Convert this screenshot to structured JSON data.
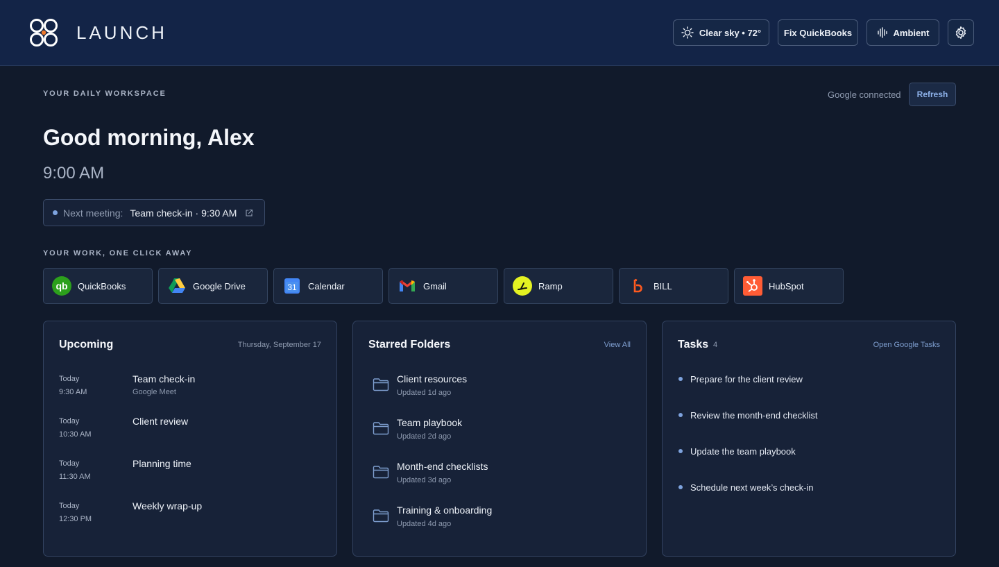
{
  "header": {
    "brand": "LAUNCH",
    "weather_label": "Clear sky • 72°",
    "fix_label": "Fix QuickBooks",
    "ambient_label": "Ambient"
  },
  "workspace": {
    "eyebrow": "YOUR DAILY WORKSPACE",
    "google_status": "Google connected",
    "refresh_label": "Refresh",
    "greeting": "Good morning, Alex",
    "time": "9:00 AM",
    "next_meeting_label": "Next meeting:",
    "next_meeting_value": "Team check-in · 9:30 AM"
  },
  "apps": {
    "eyebrow": "YOUR WORK, ONE CLICK AWAY",
    "items": [
      {
        "label": "QuickBooks",
        "icon": "quickbooks-icon"
      },
      {
        "label": "Google Drive",
        "icon": "google-drive-icon"
      },
      {
        "label": "Calendar",
        "icon": "calendar-icon"
      },
      {
        "label": "Gmail",
        "icon": "gmail-icon"
      },
      {
        "label": "Ramp",
        "icon": "ramp-icon"
      },
      {
        "label": "BILL",
        "icon": "bill-icon"
      },
      {
        "label": "HubSpot",
        "icon": "hubspot-icon"
      }
    ]
  },
  "upcoming": {
    "title": "Upcoming",
    "date": "Thursday, September 17",
    "events": [
      {
        "day": "Today",
        "time": "9:30 AM",
        "title": "Team check-in",
        "sub": "Google Meet"
      },
      {
        "day": "Today",
        "time": "10:30 AM",
        "title": "Client review",
        "sub": ""
      },
      {
        "day": "Today",
        "time": "11:30 AM",
        "title": "Planning time",
        "sub": ""
      },
      {
        "day": "Today",
        "time": "12:30 PM",
        "title": "Weekly wrap-up",
        "sub": ""
      }
    ]
  },
  "folders": {
    "title": "Starred Folders",
    "link": "View All",
    "items": [
      {
        "name": "Client resources",
        "updated": "Updated 1d ago"
      },
      {
        "name": "Team playbook",
        "updated": "Updated 2d ago"
      },
      {
        "name": "Month-end checklists",
        "updated": "Updated 3d ago"
      },
      {
        "name": "Training & onboarding",
        "updated": "Updated 4d ago"
      }
    ]
  },
  "tasks": {
    "title": "Tasks",
    "count": "4",
    "link": "Open Google Tasks",
    "items": [
      {
        "label": "Prepare for the client review"
      },
      {
        "label": "Review the month-end checklist"
      },
      {
        "label": "Update the team playbook"
      },
      {
        "label": "Schedule next week’s check-in"
      }
    ]
  },
  "colors": {
    "background": "#111a2b",
    "header": "#132447",
    "accent": "#7ea3de",
    "panel": "#172238"
  }
}
